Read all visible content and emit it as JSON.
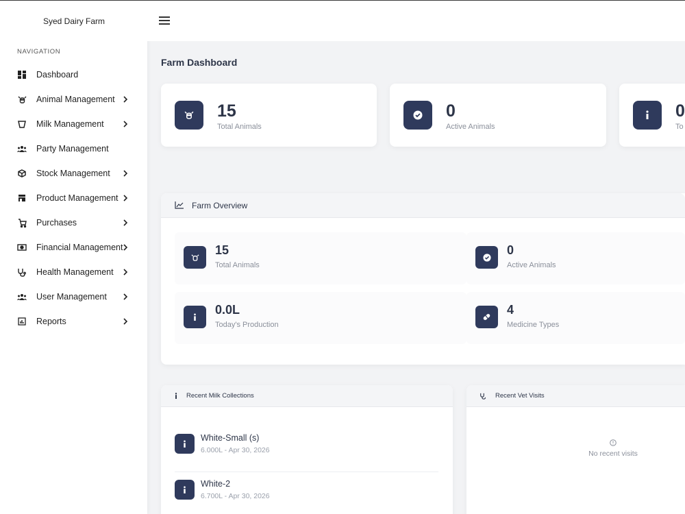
{
  "brand": "Syed Dairy Farm",
  "nav_caption": "NAVIGATION",
  "nav_items": [
    {
      "label": "Dashboard",
      "icon": "dashboard-icon"
    },
    {
      "label": "Animal Management",
      "icon": "cow-icon"
    },
    {
      "label": "Milk Management",
      "icon": "bucket-icon"
    },
    {
      "label": "Party Management",
      "icon": "users-icon"
    },
    {
      "label": "Stock Management",
      "icon": "box-icon"
    },
    {
      "label": "Product Management",
      "icon": "store-icon"
    },
    {
      "label": "Purchases",
      "icon": "cart-icon"
    },
    {
      "label": "Financial Management",
      "icon": "money-icon"
    },
    {
      "label": "Health Management",
      "icon": "stethoscope-icon"
    },
    {
      "label": "User Management",
      "icon": "users-icon"
    },
    {
      "label": "Reports",
      "icon": "report-icon"
    }
  ],
  "page_title": "Farm Dashboard",
  "stats": [
    {
      "value": "15",
      "label": "Total Animals",
      "icon": "cow-icon"
    },
    {
      "value": "0",
      "label": "Active Animals",
      "icon": "check-circle-icon"
    },
    {
      "value": "0",
      "label": "To",
      "icon": "info-icon"
    }
  ],
  "overview": {
    "title": "Farm Overview",
    "tiles": [
      {
        "value": "15",
        "label": "Total Animals",
        "icon": "cow-icon"
      },
      {
        "value": "0",
        "label": "Active Animals",
        "icon": "check-circle-icon"
      },
      {
        "value": "0.0L",
        "label": "Today's Production",
        "icon": "info-icon"
      },
      {
        "value": "4",
        "label": "Medicine Types",
        "icon": "pill-icon"
      }
    ]
  },
  "milk_collections": {
    "title": "Recent Milk Collections",
    "items": [
      {
        "name": "White-Small (s)",
        "detail": "6.000L - Apr 30, 2026"
      },
      {
        "name": "White-2",
        "detail": "6.700L - Apr 30, 2026"
      }
    ]
  },
  "vet_visits": {
    "title": "Recent Vet Visits",
    "empty": "No recent visits"
  },
  "colors": {
    "accent": "#2f3a5c",
    "background": "#f2f3f5"
  }
}
